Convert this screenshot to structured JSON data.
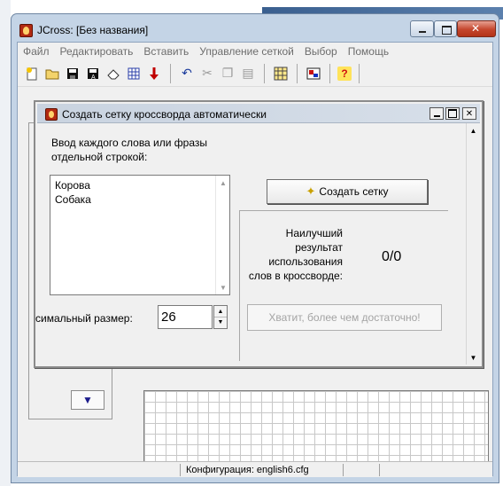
{
  "app": {
    "title": "JCross: [Без названия]"
  },
  "menu": [
    "Файл",
    "Редактировать",
    "Вставить",
    "Управление сеткой",
    "Выбор",
    "Помощь"
  ],
  "toolbar": {
    "icons": [
      "new-file-icon",
      "open-folder-icon",
      "save-icon",
      "save-as-icon",
      "eraser-icon",
      "grid-pattern-icon",
      "red-down-arrow-icon",
      "undo-icon",
      "cut-icon",
      "copy-icon",
      "paste-icon",
      "grid-icon",
      "config-icon",
      "help-icon"
    ]
  },
  "status": {
    "config": "Конфигурация: english6.cfg"
  },
  "dialog": {
    "title": "Создать сетку кроссворда автоматически",
    "instructions": "Ввод каждого слова или фразы отдельной строкой:",
    "words": "Корова\nСобака",
    "size_label": "симальный размер:",
    "size_value": "26",
    "create_button": "Создать сетку",
    "result_label": "Наилучший результат использования слов в кроссворде:",
    "result_value": "0/0",
    "enough_button": "Хватит, более чем достаточно!"
  },
  "colors": {
    "window_frame": "#c4d4e6",
    "close_button": "#c4452c",
    "disabled_text": "#a4a4a4"
  }
}
